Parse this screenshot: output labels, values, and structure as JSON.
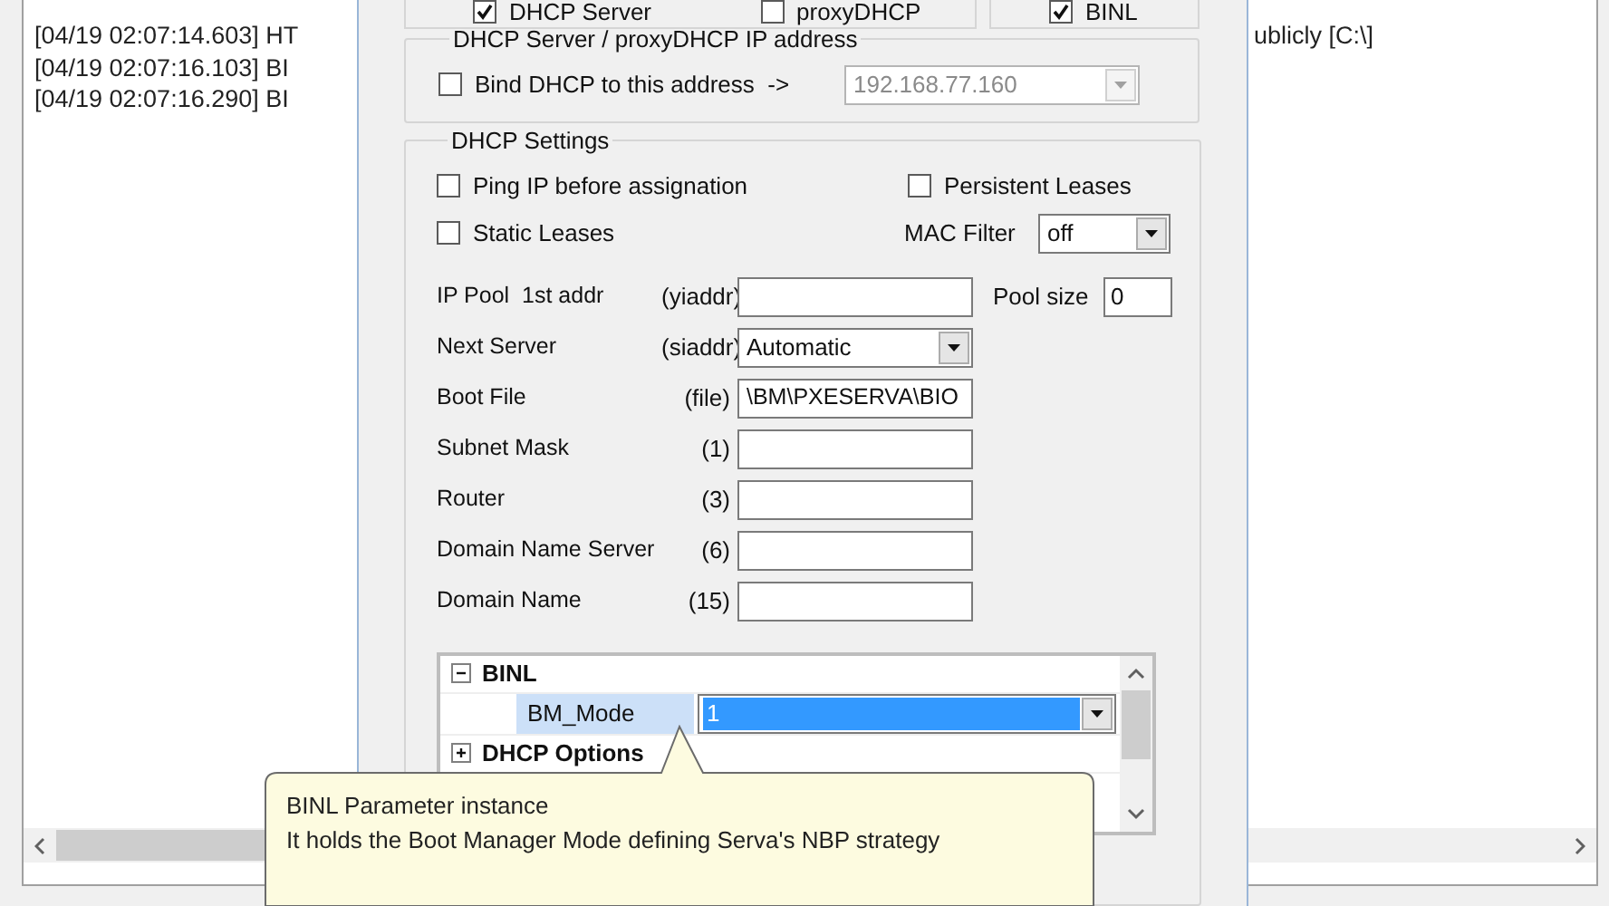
{
  "log": {
    "lines": [
      "[04/19 02:07:14.603] HT",
      "[04/19 02:07:16.103] BI",
      "[04/19 02:07:16.290] BI"
    ],
    "right_fragment": "ublicly [C:\\]"
  },
  "dialog": {
    "top_checks": [
      {
        "label": "DHCP Server",
        "checked": true
      },
      {
        "label": "proxyDHCP",
        "checked": false
      },
      {
        "label": "BINL",
        "checked": true
      }
    ],
    "ip_group": {
      "title": "DHCP Server / proxyDHCP IP address",
      "bind": {
        "label": "Bind DHCP to this address  ->",
        "checked": false
      },
      "address": {
        "value": "192.168.77.160",
        "disabled": true
      }
    },
    "settings": {
      "title": "DHCP Settings",
      "ping": {
        "label": "Ping IP before assignation",
        "checked": false
      },
      "persistent": {
        "label": "Persistent Leases",
        "checked": false
      },
      "static": {
        "label": "Static Leases",
        "checked": false
      },
      "mac_filter": {
        "label": "MAC Filter",
        "value": "off"
      },
      "fields": [
        {
          "label": "IP Pool  1st addr",
          "code": "(yiaddr)",
          "kind": "text"
        },
        {
          "label": "Next Server",
          "code": "(siaddr)",
          "kind": "select",
          "value": "Automatic"
        },
        {
          "label": "Boot File",
          "code": "(file)",
          "kind": "text",
          "value": "\\BM\\PXESERVA\\BIO"
        },
        {
          "label": "Subnet Mask",
          "code": "(1)",
          "kind": "text"
        },
        {
          "label": "Router",
          "code": "(3)",
          "kind": "text"
        },
        {
          "label": "Domain Name Server",
          "code": "(6)",
          "kind": "text"
        },
        {
          "label": "Domain Name",
          "code": "(15)",
          "kind": "text"
        }
      ],
      "pool_size": {
        "label": "Pool size",
        "value": "0"
      },
      "property_grid": {
        "rows": [
          {
            "label": "BINL",
            "expanded": true,
            "children": [
              {
                "label": "BM_Mode",
                "value": "1",
                "selected": true
              }
            ]
          },
          {
            "label": "DHCP Options",
            "expanded": false
          }
        ]
      }
    }
  },
  "tooltip": {
    "lines": [
      "BINL Parameter instance",
      "It holds the Boot Manager Mode defining Serva's NBP strategy"
    ]
  }
}
